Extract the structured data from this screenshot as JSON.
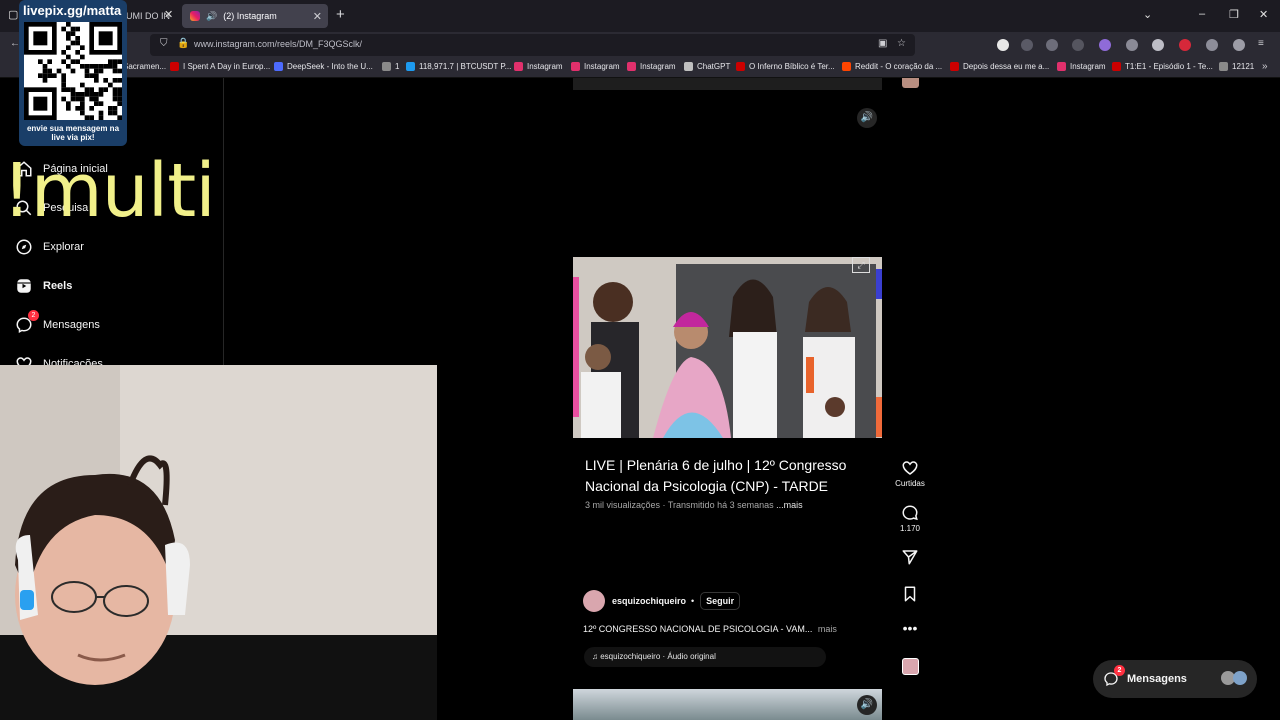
{
  "browser": {
    "tabs": [
      {
        "title": "UMI DO IN"
      },
      {
        "title": "(2) Instagram"
      }
    ],
    "url": "www.instagram.com/reels/DM_F3QGSclk/",
    "bookmarks": [
      {
        "label": "Sacramen...",
        "color": "#cc0000"
      },
      {
        "label": "I Spent A Day in Europ...",
        "color": "#cc0000"
      },
      {
        "label": "DeepSeek - Into the U...",
        "color": "#4d6bfe"
      },
      {
        "label": "1",
        "color": "#8a8a8a"
      },
      {
        "label": "118,971.7 | BTCUSDT P...",
        "color": "#1d9bf0"
      },
      {
        "label": "Instagram",
        "color": "#e1306c"
      },
      {
        "label": "Instagram",
        "color": "#e1306c"
      },
      {
        "label": "Instagram",
        "color": "#e1306c"
      },
      {
        "label": "ChatGPT",
        "color": "#bfbfbf"
      },
      {
        "label": "O Inferno Bíblico é Ter...",
        "color": "#cc0000"
      },
      {
        "label": "Reddit - O coração da ...",
        "color": "#ff4500"
      },
      {
        "label": "Depois dessa eu me a...",
        "color": "#cc0000"
      },
      {
        "label": "Instagram",
        "color": "#e1306c"
      },
      {
        "label": "T1:E1 - Episódio 1 - Te...",
        "color": "#cc0000"
      },
      {
        "label": "12121",
        "color": "#8a8a8a"
      }
    ]
  },
  "sidebar": {
    "home": "Página inicial",
    "search": "Pesquisa",
    "explore": "Explorar",
    "reels": "Reels",
    "messages": "Mensagens",
    "messages_badge": "2",
    "notifications": "Notificações"
  },
  "reel": {
    "title": "LIVE | Plenária 6 de julho | 12º Congresso Nacional da Psicologia (CNP) - TARDE",
    "views": "3 mil visualizações",
    "streamed": "Transmitido há 3 semanas",
    "more": "...mais",
    "likes_label": "Curtidas",
    "comments": "1.170",
    "username": "esquizochiqueiro",
    "follow": "Seguir",
    "separator": "•",
    "caption": "12º CONGRESSO NACIONAL DE PSICOLOGIA - VAM...",
    "caption_more": "mais",
    "audio": "esquizochiqueiro · Áudio original"
  },
  "floating": {
    "messages_label": "Mensagens",
    "messages_badge": "2"
  },
  "overlay": {
    "qr_title": "livepix.gg/matta",
    "qr_note": "envie sua mensagem na live via pix!",
    "multi_text": "!multi"
  },
  "colors": {
    "badge": "#ff3040",
    "overlay_text": "#f1f08a",
    "qr_panel": "#1a3e68"
  }
}
